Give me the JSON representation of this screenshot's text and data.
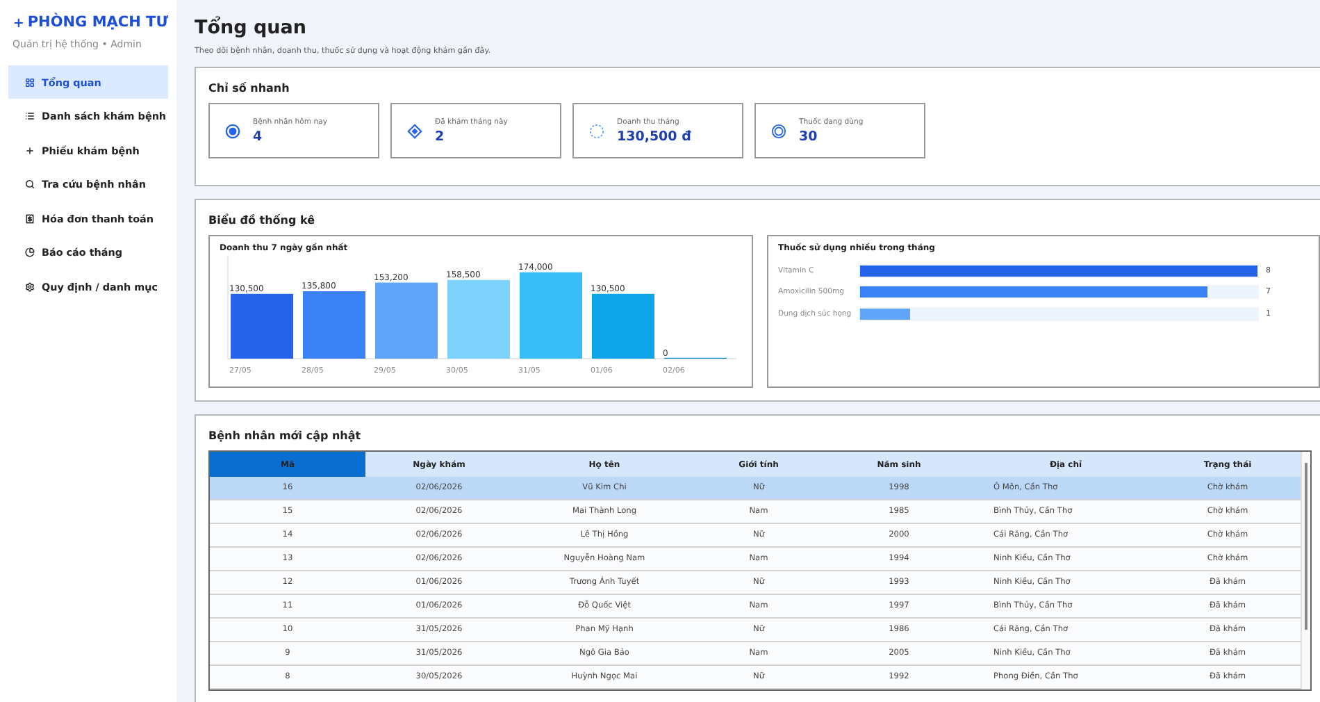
{
  "sidebar": {
    "brand": "PHÒNG MẠCH TƯ",
    "subtitle": "Quản trị hệ thống • Admin",
    "items": [
      {
        "label": "Tổng quan",
        "selected": true
      },
      {
        "label": "Danh sách khám bệnh",
        "selected": false
      },
      {
        "label": "Phiếu khám bệnh",
        "selected": false
      },
      {
        "label": "Tra cứu bệnh nhân",
        "selected": false
      },
      {
        "label": "Hóa đơn thanh toán",
        "selected": false
      },
      {
        "label": "Báo cáo tháng",
        "selected": false
      },
      {
        "label": "Quy định / danh mục",
        "selected": false
      }
    ]
  },
  "header": {
    "title": "Tổng quan",
    "subtitle": "Theo dõi bệnh nhân, doanh thu, thuốc sử dụng và hoạt động khám gần đây."
  },
  "quick_stats": {
    "title": "Chỉ số nhanh",
    "cards": [
      {
        "label": "Bệnh nhân hôm nay",
        "value": "4"
      },
      {
        "label": "Đã khám tháng này",
        "value": "2"
      },
      {
        "label": "Doanh thu tháng",
        "value": "130,500 đ"
      },
      {
        "label": "Thuốc đang dùng",
        "value": "30"
      }
    ]
  },
  "charts": {
    "title": "Biểu đồ thống kê",
    "revenue": {
      "chart_data": {
        "type": "bar",
        "title": "Doanh thu 7 ngày gần nhất",
        "categories": [
          "27/05",
          "28/05",
          "29/05",
          "30/05",
          "31/05",
          "01/06",
          "02/06"
        ],
        "values": [
          130500,
          135800,
          153200,
          158500,
          174000,
          130500,
          0
        ],
        "value_labels": [
          "130,500",
          "135,800",
          "153,200",
          "158,500",
          "174,000",
          "130,500",
          "0"
        ]
      }
    },
    "medicines": {
      "chart_data": {
        "type": "bar",
        "orientation": "horizontal",
        "title": "Thuốc sử dụng nhiều trong tháng",
        "categories": [
          "Vitamin C",
          "Amoxicilin 500mg",
          "Dung dịch súc họng"
        ],
        "values": [
          8,
          7,
          1
        ],
        "data_labels": true
      }
    }
  },
  "patients": {
    "title": "Bệnh nhân mới cập nhật",
    "columns": [
      {
        "label": "Mã",
        "selected": true
      },
      {
        "label": "Ngày khám",
        "selected": false
      },
      {
        "label": "Họ tên",
        "selected": false
      },
      {
        "label": "Giới tính",
        "selected": false
      },
      {
        "label": "Năm sinh",
        "selected": false
      },
      {
        "label": "Địa chỉ",
        "selected": false
      },
      {
        "label": "Trạng thái",
        "selected": false
      }
    ],
    "rows": [
      {
        "cells": [
          "16",
          "02/06/2026",
          "Vũ Kim Chi",
          "Nữ",
          "1998",
          "Ô Môn, Cần Thơ",
          "Chờ khám"
        ],
        "selected": true
      },
      {
        "cells": [
          "15",
          "02/06/2026",
          "Mai Thành Long",
          "Nam",
          "1985",
          "Bình Thủy, Cần Thơ",
          "Chờ khám"
        ],
        "selected": false
      },
      {
        "cells": [
          "14",
          "02/06/2026",
          "Lê Thị Hồng",
          "Nữ",
          "2000",
          "Cái Răng, Cần Thơ",
          "Chờ khám"
        ],
        "selected": false
      },
      {
        "cells": [
          "13",
          "02/06/2026",
          "Nguyễn Hoàng Nam",
          "Nam",
          "1994",
          "Ninh Kiều, Cần Thơ",
          "Chờ khám"
        ],
        "selected": false
      },
      {
        "cells": [
          "12",
          "01/06/2026",
          "Trương Ánh Tuyết",
          "Nữ",
          "1993",
          "Ninh Kiều, Cần Thơ",
          "Đã khám"
        ],
        "selected": false
      },
      {
        "cells": [
          "11",
          "01/06/2026",
          "Đỗ Quốc Việt",
          "Nam",
          "1997",
          "Bình Thủy, Cần Thơ",
          "Đã khám"
        ],
        "selected": false
      },
      {
        "cells": [
          "10",
          "31/05/2026",
          "Phan Mỹ Hạnh",
          "Nữ",
          "1986",
          "Cái Răng, Cần Thơ",
          "Đã khám"
        ],
        "selected": false
      },
      {
        "cells": [
          "9",
          "31/05/2026",
          "Ngô Gia Bảo",
          "Nam",
          "2005",
          "Ninh Kiều, Cần Thơ",
          "Đã khám"
        ],
        "selected": false
      },
      {
        "cells": [
          "8",
          "30/05/2026",
          "Huỳnh Ngọc Mai",
          "Nữ",
          "1992",
          "Phong Điền, Cần Thơ",
          "Đã khám"
        ],
        "selected": false
      }
    ]
  }
}
